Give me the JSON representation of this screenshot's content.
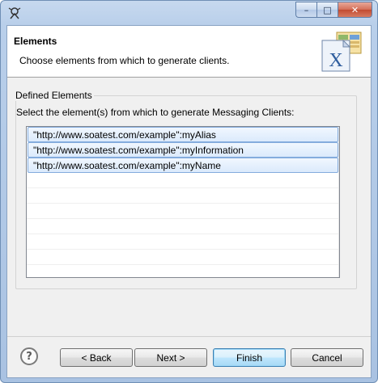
{
  "window": {
    "icon": "wizard-icon",
    "controls": {
      "minimize_glyph": "–",
      "maximize_glyph": "□",
      "close_glyph": "✕"
    }
  },
  "header": {
    "title": "Elements",
    "description": "Choose elements from which to generate clients.",
    "icon": "xml-schema-icon"
  },
  "group": {
    "legend": "Defined Elements",
    "instruction": "Select the element(s) from which to generate Messaging Clients:"
  },
  "list": {
    "items": [
      {
        "label": "\"http://www.soatest.com/example\":myAlias",
        "selected": true
      },
      {
        "label": "\"http://www.soatest.com/example\":myInformation",
        "selected": true
      },
      {
        "label": "\"http://www.soatest.com/example\":myName",
        "selected": true
      }
    ]
  },
  "buttons": {
    "help": "?",
    "back": "< Back",
    "next": "Next >",
    "finish": "Finish",
    "cancel": "Cancel"
  },
  "colors": {
    "frame": "#b9cfea",
    "selection": "#dbeafc",
    "selection_border": "#84acdd",
    "default_button": "#bee6fd"
  }
}
